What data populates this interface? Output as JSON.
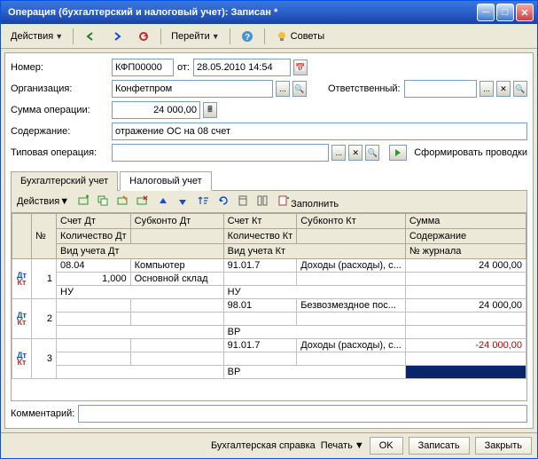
{
  "window_title": "Операция (бухгалтерский и налоговый учет): Записан *",
  "toolbar": {
    "actions": "Действия",
    "goto": "Перейти",
    "advice": "Советы"
  },
  "form": {
    "number_label": "Номер:",
    "number": "КФП00000",
    "from_label": "от:",
    "date": "28.05.2010 14:54",
    "org_label": "Организация:",
    "org": "Конфетпром",
    "resp_label": "Ответственный:",
    "resp": "",
    "sum_label": "Сумма операции:",
    "sum": "24 000,00",
    "content_label": "Содержание:",
    "content": "отражение ОС на 08 счет",
    "typical_label": "Типовая операция:",
    "typical": "",
    "gen_entries": "Сформировать проводки",
    "comment_label": "Комментарий:",
    "comment": ""
  },
  "tabs": {
    "buh": "Бухгалтерский учет",
    "tax": "Налоговый учет"
  },
  "subtoolbar": {
    "actions": "Действия",
    "fill": "Заполнить"
  },
  "headers": {
    "num": "№",
    "dt_acc": "Счет Дт",
    "dt_sub": "Субконто Дт",
    "kt_acc": "Счет Кт",
    "kt_sub": "Субконто Кт",
    "sum": "Сумма",
    "dt_qty": "Количество Дт",
    "kt_qty": "Количество Кт",
    "content": "Содержание",
    "dt_type": "Вид учета Дт",
    "kt_type": "Вид учета Кт",
    "journal": "№ журнала"
  },
  "rows": [
    {
      "num": "1",
      "dt_acc": "08.04",
      "dt_sub": "Компьютер",
      "kt_acc": "91.01.7",
      "kt_sub": "Доходы (расходы), с...",
      "sum": "24 000,00",
      "dt_qty": "1,000",
      "dt_sub2": "Основной склад",
      "dt_type": "НУ",
      "kt_type": "НУ"
    },
    {
      "num": "2",
      "dt_acc": "",
      "dt_sub": "",
      "kt_acc": "98.01",
      "kt_sub": "Безвозмездное пос...",
      "sum": "24 000,00",
      "dt_type": "",
      "kt_type": "ВР"
    },
    {
      "num": "3",
      "dt_acc": "",
      "dt_sub": "",
      "kt_acc": "91.01.7",
      "kt_sub": "Доходы (расходы), с...",
      "sum": "-24 000,00",
      "neg": true,
      "dt_type": "",
      "kt_type": "ВР"
    }
  ],
  "footer": {
    "ref": "Бухгалтерская справка",
    "print": "Печать",
    "ok": "OK",
    "save": "Записать",
    "close": "Закрыть"
  }
}
